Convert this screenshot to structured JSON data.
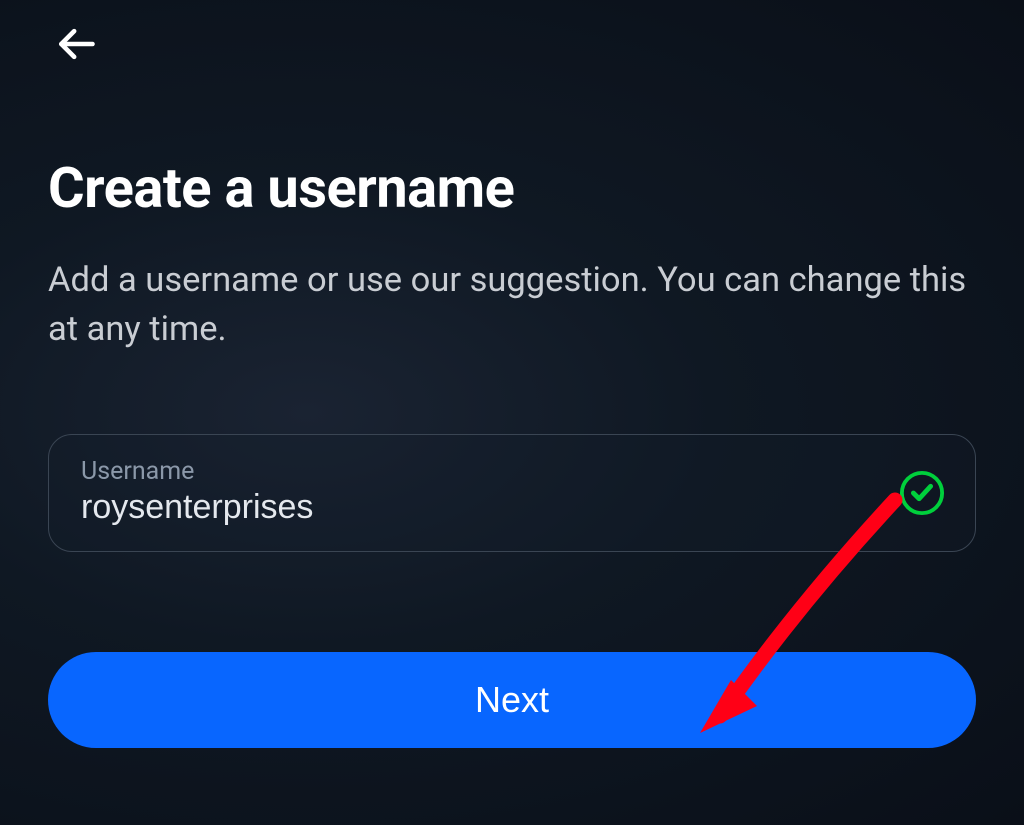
{
  "header": {
    "back_icon": "arrow-left"
  },
  "page": {
    "title": "Create a username",
    "subtitle": "Add a username or use our suggestion. You can change this at any time."
  },
  "form": {
    "username": {
      "label": "Username",
      "value": "roysenterprises",
      "status": "valid"
    }
  },
  "actions": {
    "next_label": "Next"
  },
  "colors": {
    "primary": "#0866ff",
    "success": "#00c853",
    "bg": "#0f1823"
  }
}
